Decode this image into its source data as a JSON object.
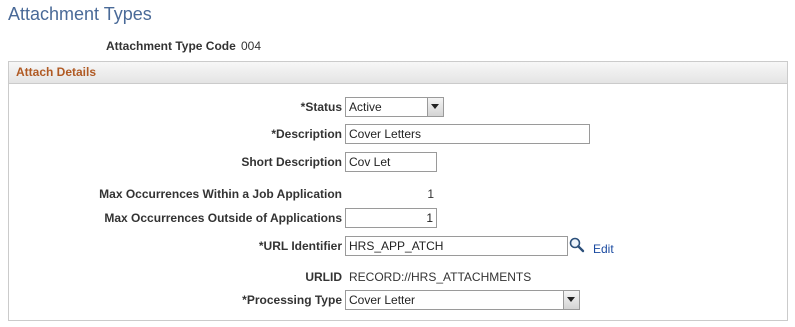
{
  "page": {
    "title": "Attachment Types"
  },
  "header": {
    "code_label": "Attachment Type Code",
    "code_value": "004"
  },
  "details": {
    "title": "Attach Details",
    "status": {
      "label": "*Status",
      "value": "Active"
    },
    "description": {
      "label": "*Description",
      "value": "Cover Letters"
    },
    "short_description": {
      "label": "Short Description",
      "value": "Cov Let"
    },
    "max_within": {
      "label": "Max Occurrences Within a Job Application",
      "value": "1"
    },
    "max_outside": {
      "label": "Max Occurrences Outside of Applications",
      "value": "1"
    },
    "url_identifier": {
      "label": "*URL Identifier",
      "value": "HRS_APP_ATCH",
      "edit_label": "Edit",
      "lookup_icon": "magnifier-icon"
    },
    "urlid": {
      "label": "URLID",
      "value": "RECORD://HRS_ATTACHMENTS"
    },
    "processing_type": {
      "label": "*Processing Type",
      "value": "Cover Letter"
    }
  },
  "colors": {
    "title": "#4a6a98",
    "group_title": "#b05a24",
    "link": "#1a4aa0"
  }
}
